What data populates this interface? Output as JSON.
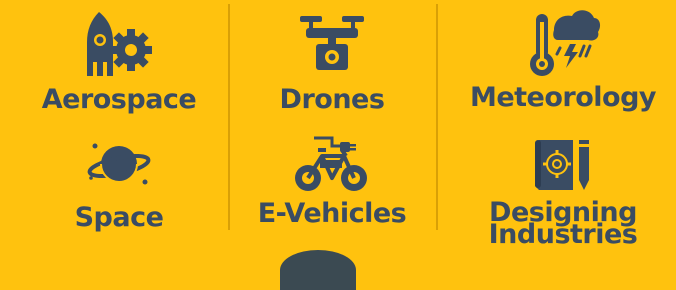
{
  "colors": {
    "background": "#FFC20E",
    "icon": "#3A4C63",
    "text": "#3A4C63",
    "divider": "#D9A006"
  },
  "items": [
    {
      "label": "Aerospace",
      "icon": "rocket-gear-icon"
    },
    {
      "label": "Drones",
      "icon": "drone-camera-icon"
    },
    {
      "label": "Meteorology",
      "icon": "thermometer-storm-icon"
    },
    {
      "label": "Space",
      "icon": "planet-icon"
    },
    {
      "label": "E-Vehicles",
      "icon": "electric-bicycle-icon"
    },
    {
      "label_lines": [
        "Designing",
        "Industries"
      ],
      "icon": "blueprint-gear-pencil-icon"
    }
  ]
}
